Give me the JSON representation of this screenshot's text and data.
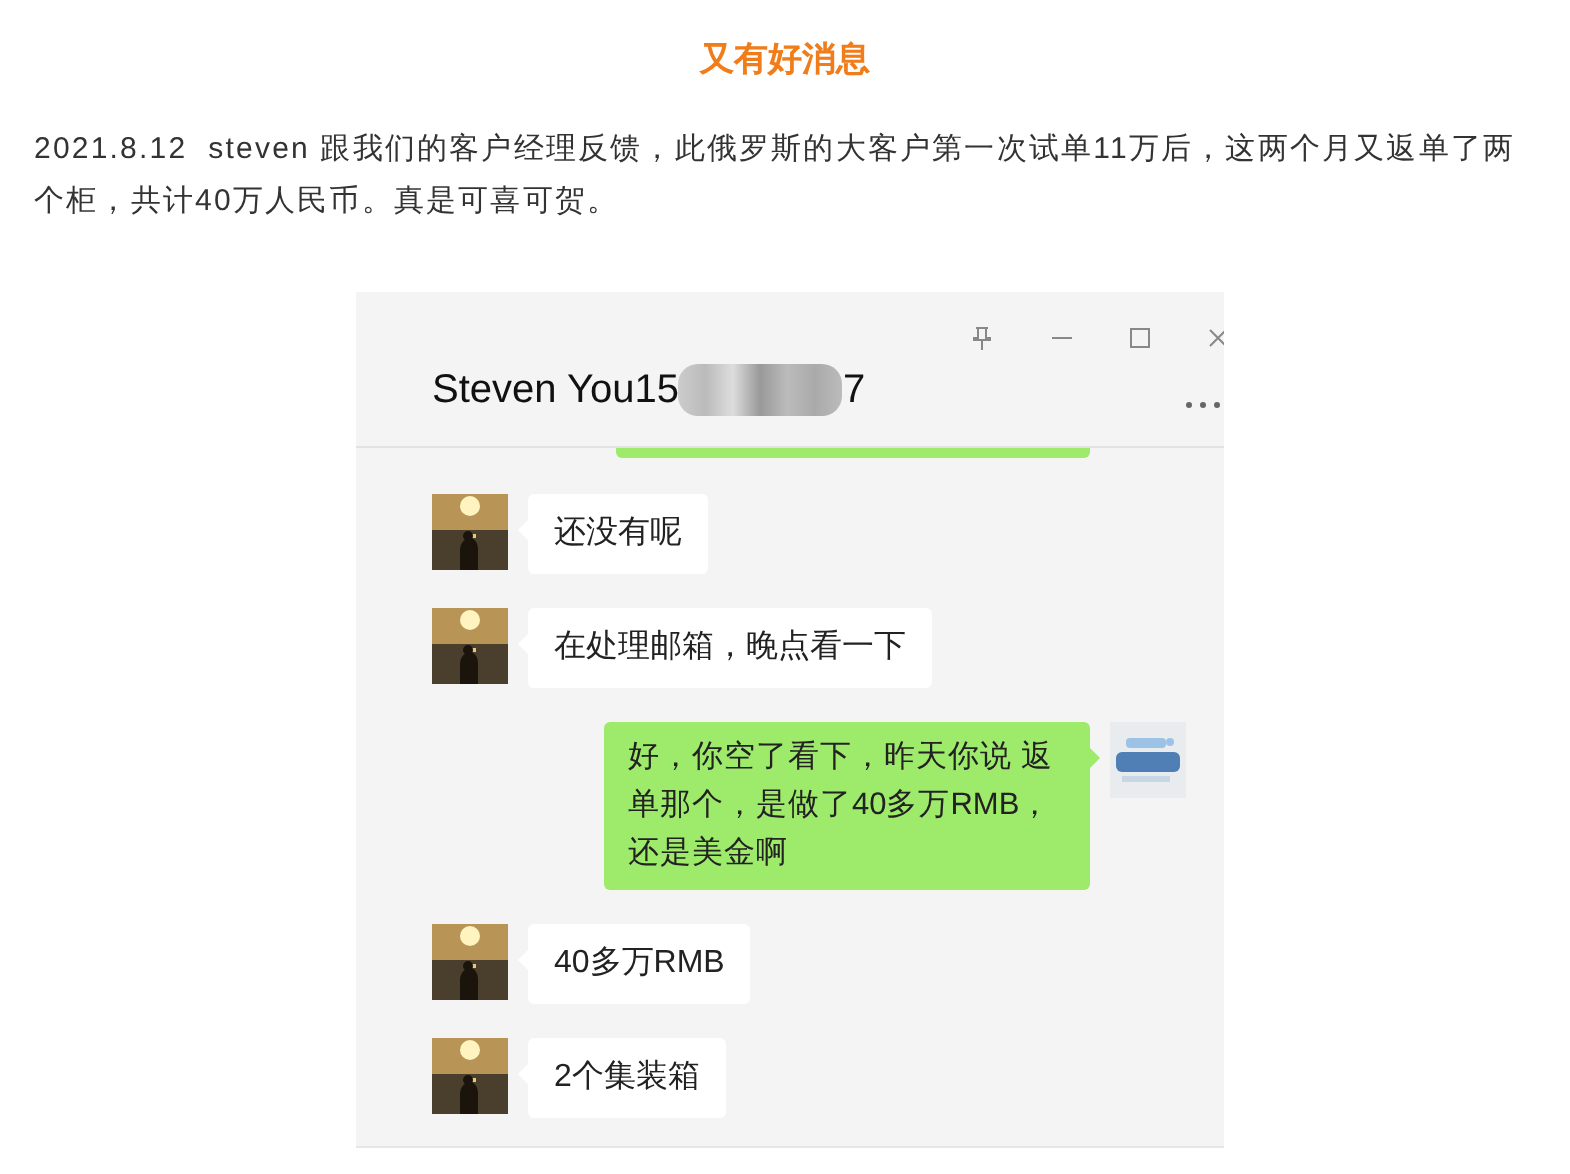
{
  "heading": "又有好消息",
  "paragraph": "2021.8.12  steven 跟我们的客户经理反馈，此俄罗斯的大客户第一次试单11万后，这两个月又返单了两个柜，共计40万人民币。真是可喜可贺。",
  "chat_window": {
    "title_start": "Steven You15",
    "title_end": "7",
    "messages": [
      {
        "kind": "received",
        "text": "还没有呢"
      },
      {
        "kind": "received",
        "text": "在处理邮箱，晚点看一下"
      },
      {
        "kind": "sent",
        "text": "好，你空了看下，昨天你说 返单那个，是做了40多万RMB，还是美金啊"
      },
      {
        "kind": "received",
        "text": "40多万RMB"
      },
      {
        "kind": "received",
        "text": "2个集装箱"
      }
    ]
  }
}
